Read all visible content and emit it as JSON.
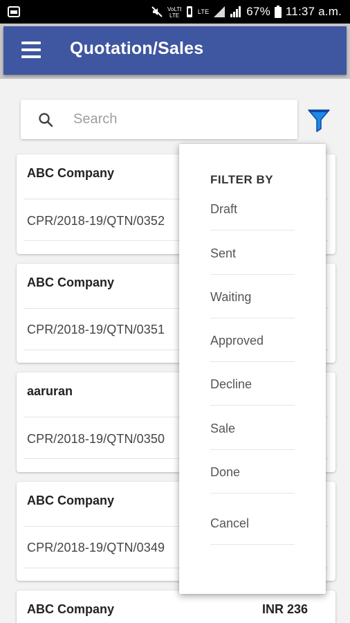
{
  "status_bar": {
    "battery": "67%",
    "time": "11:37 a.m.",
    "network_label": "LTE"
  },
  "app_bar": {
    "title": "Quotation/Sales",
    "menu_icon": "hamburger-menu-icon",
    "color": "#3f56a0"
  },
  "search": {
    "placeholder": "Search",
    "value": ""
  },
  "filter_icon": {
    "name": "filter-funnel-icon",
    "color": "#1e88e5"
  },
  "cards": [
    {
      "name": "ABC Company",
      "code": "CPR/2018-19/QTN/0352",
      "amount": ""
    },
    {
      "name": "ABC Company",
      "code": "CPR/2018-19/QTN/0351",
      "amount": ""
    },
    {
      "name": "aaruran",
      "code": "CPR/2018-19/QTN/0350",
      "amount": ""
    },
    {
      "name": "ABC Company",
      "code": "CPR/2018-19/QTN/0349",
      "amount": ""
    },
    {
      "name": "ABC Company",
      "code": "",
      "amount": "INR 236"
    }
  ],
  "filter_popup": {
    "title": "FILTER BY",
    "options": [
      "Draft",
      "Sent",
      "Waiting",
      "Approved",
      "Decline",
      "Sale",
      "Done"
    ],
    "cancel": "Cancel"
  }
}
